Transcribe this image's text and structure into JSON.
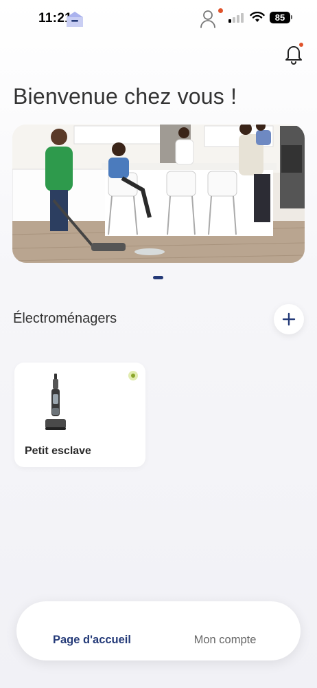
{
  "status_bar": {
    "time": "11:21",
    "battery": "85",
    "icons": [
      "signal-icon",
      "wifi-icon",
      "battery-icon"
    ]
  },
  "header": {
    "notification_icon": "bell-icon",
    "notification_badge_color": "#e0532b"
  },
  "page": {
    "title": "Bienvenue chez vous !"
  },
  "hero": {
    "carousel_pages": 1,
    "active_page": 1
  },
  "appliances": {
    "section_title": "Électroménagers",
    "add_icon": "plus-icon",
    "items": [
      {
        "name": "Petit esclave",
        "image": "wet-dry-vacuum",
        "status": "online",
        "status_color": "#8aa62a"
      }
    ]
  },
  "bottom_nav": {
    "items": [
      {
        "label": "Page d'accueil",
        "icon": "home-icon",
        "active": true
      },
      {
        "label": "Mon compte",
        "icon": "user-icon",
        "active": false,
        "badge": true
      }
    ]
  },
  "colors": {
    "accent": "#243a78",
    "badge": "#e0532b",
    "text_primary": "#333333",
    "text_secondary": "#666666"
  }
}
